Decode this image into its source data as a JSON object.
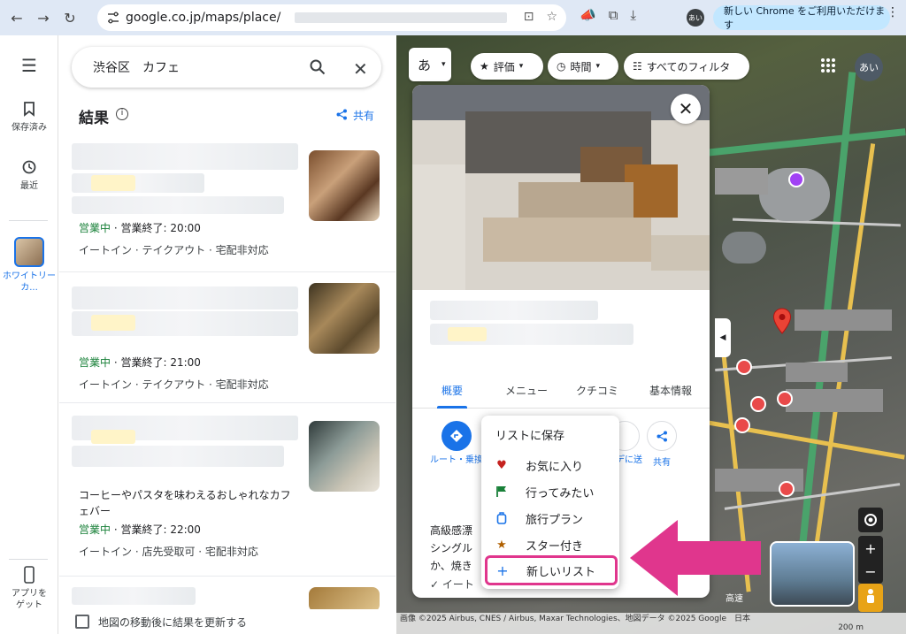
{
  "browser": {
    "url": "google.co.jp/maps/place/",
    "update_button_label": "新しい Chrome をご利用いただけます",
    "profile_initials": "あい"
  },
  "rail": {
    "saved_label": "保存済み",
    "recent_label": "最近",
    "selected_place_label": "ホワイトリー カ...",
    "get_app_label": "アプリをゲット"
  },
  "search": {
    "query": "渋谷区　カフェ"
  },
  "results": {
    "title": "結果",
    "share_label": "共有",
    "cards": [
      {
        "open": "営業中",
        "hours": " · 営業終了: 20:00",
        "services": "イートイン · テイクアウト · 宅配非対応",
        "desc": ""
      },
      {
        "open": "営業中",
        "hours": " · 営業終了: 21:00",
        "services": "イートイン · テイクアウト · 宅配非対応",
        "desc": ""
      },
      {
        "open": "営業中",
        "hours": " · 営業終了: 22:00",
        "services": "イートイン · 店先受取可 · 宅配非対応",
        "desc": "コーヒーやパスタを味わえるおしゃれなカフェバー"
      }
    ],
    "update_on_move_label": "地図の移動後に結果を更新する"
  },
  "map": {
    "lang_label": "あ",
    "chips": {
      "rating": "評価",
      "hours": "時間",
      "filters": "すべてのフィルタ"
    },
    "avatar_initials": "あい",
    "footer_text": "画像 ©2025 Airbus, CNES / Airbus, Maxar Technologies、地図データ ©2025 Google　日本",
    "scale_label": "200 m",
    "highway_label": "高速"
  },
  "place": {
    "tabs": [
      "概要",
      "メニュー",
      "クチコミ",
      "基本情報"
    ],
    "actions": {
      "route": "ルート・乗換",
      "send": "ルデに送",
      "share": "共有"
    },
    "desc": "高級感漂　　　　　　　ヒーや\nシングル　　　　　　えるほ\nか、焼き",
    "services": "✓ イート　　　　　　　　　　　宅配"
  },
  "save_menu": {
    "title": "リストに保存",
    "items": [
      {
        "label": "お気に入り",
        "icon": "heart-icon",
        "color": "#c5221f"
      },
      {
        "label": "行ってみたい",
        "icon": "flag-icon",
        "color": "#188038"
      },
      {
        "label": "旅行プラン",
        "icon": "suitcase-icon",
        "color": "#1a73e8"
      },
      {
        "label": "スター付き",
        "icon": "star-icon",
        "color": "#b06000"
      },
      {
        "label": "新しいリスト",
        "icon": "plus-icon",
        "color": "#1a73e8"
      }
    ]
  },
  "colors": {
    "accent": "#1a73e8",
    "open_green": "#188038",
    "highlight_pink": "#e0368d"
  }
}
